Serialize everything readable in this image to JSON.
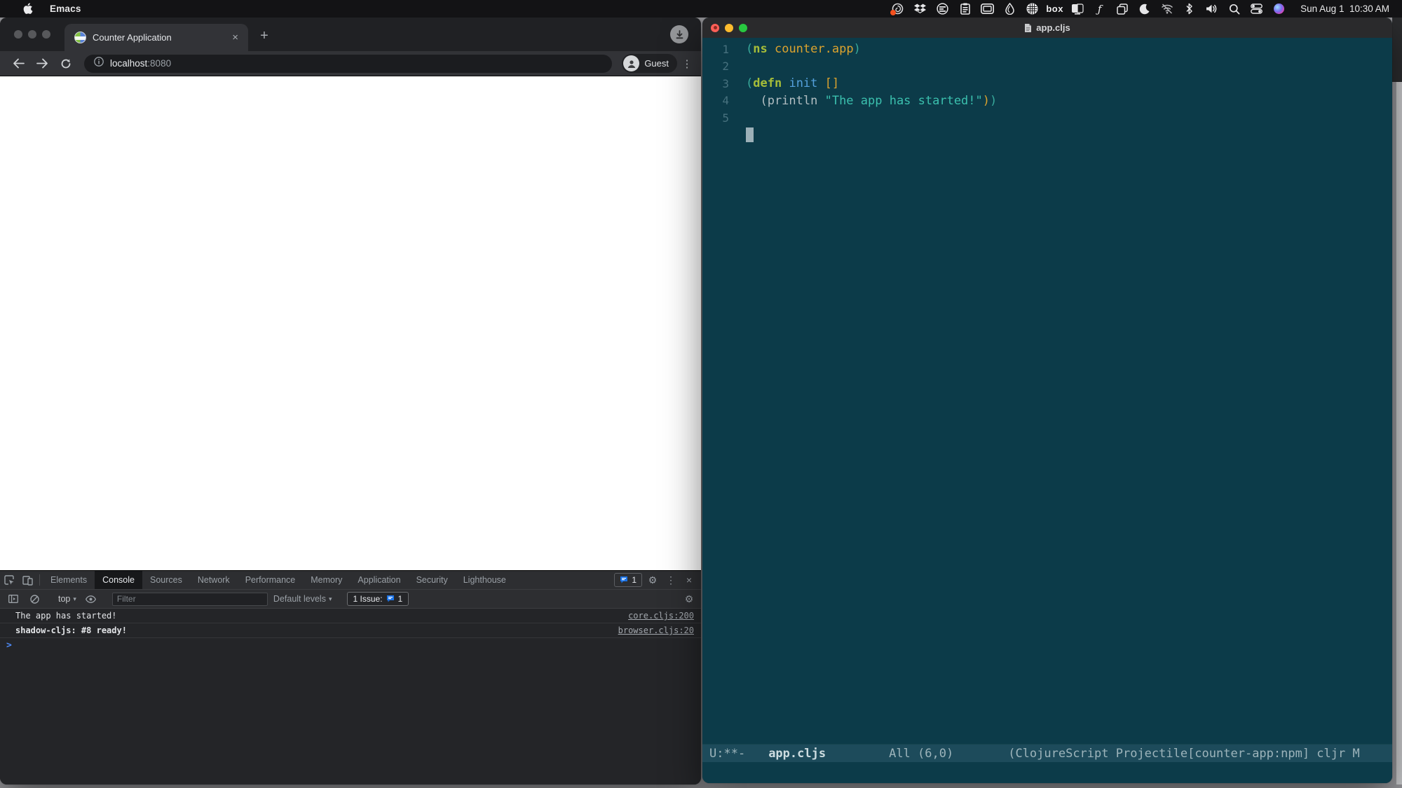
{
  "menubar": {
    "app_name": "Emacs",
    "clock": "Sun Aug 1  10:30 AM",
    "box_label": "box",
    "fn_glyph": "ƒ",
    "icons": [
      "spiral",
      "dropbox",
      "document-lines",
      "clipboard",
      "display",
      "droplet",
      "globe-grid",
      "box",
      "display-half",
      "function",
      "copy",
      "moon",
      "wifi-off",
      "bluetooth",
      "volume",
      "search",
      "control-center",
      "siri"
    ]
  },
  "chrome": {
    "tab_title": "Counter Application",
    "tab_close": "×",
    "new_tab": "+",
    "url_host": "localhost",
    "url_port": ":8080",
    "profile_label": "Guest",
    "menu_kebab": "⋮",
    "devtools": {
      "tabs": [
        "Elements",
        "Console",
        "Sources",
        "Network",
        "Performance",
        "Memory",
        "Application",
        "Security",
        "Lighthouse"
      ],
      "selected_tab": "Console",
      "issues_badge": "1",
      "gear": "⚙",
      "kebab": "⋮",
      "close": "×",
      "context_selector": "top",
      "caret": "▾",
      "filter_placeholder": "Filter",
      "levels_label": "Default levels",
      "issue_chip_text": "1 Issue:",
      "issue_chip_count": "1",
      "messages": [
        {
          "text": "The app has started!",
          "source": "core.cljs:200"
        },
        {
          "text": "shadow-cljs: #8 ready!",
          "source": "browser.cljs:20"
        }
      ],
      "prompt": ">"
    }
  },
  "emacs": {
    "window_title": "app.cljs",
    "line_numbers": [
      "1",
      "2",
      "3",
      "4",
      "5"
    ],
    "code": {
      "l1": {
        "p_open": "(",
        "kw": "ns",
        "name": " counter.app",
        "p_close": ")"
      },
      "l3": {
        "p_open": "(",
        "kw": "defn",
        "sp": " ",
        "fn": "init",
        "sp2": " ",
        "bracket": "[]"
      },
      "l4": {
        "call": "  (println ",
        "string": "\"The app has started!\"",
        "close_amber": ")",
        "close_teal": ")"
      }
    },
    "modeline": {
      "flags": "U:**-",
      "buffer": "app.cljs",
      "position": "All (6,0)",
      "modes": "(ClojureScript Projectile[counter-app:npm] cljr M"
    }
  },
  "colors": {
    "emacs_bg": "#0c3b49",
    "emacs_modeline_bg": "#1d4b5b",
    "keyword_green": "#a6bd39",
    "symbol_orange": "#dca32e",
    "function_blue": "#55a1dd",
    "string_teal": "#3bc0ae",
    "prompt_blue": "#4e8af7",
    "issue_blue": "#1a73e8",
    "traffic_red": "#ff5f57",
    "traffic_yellow": "#febc2e",
    "traffic_green": "#28c840"
  }
}
